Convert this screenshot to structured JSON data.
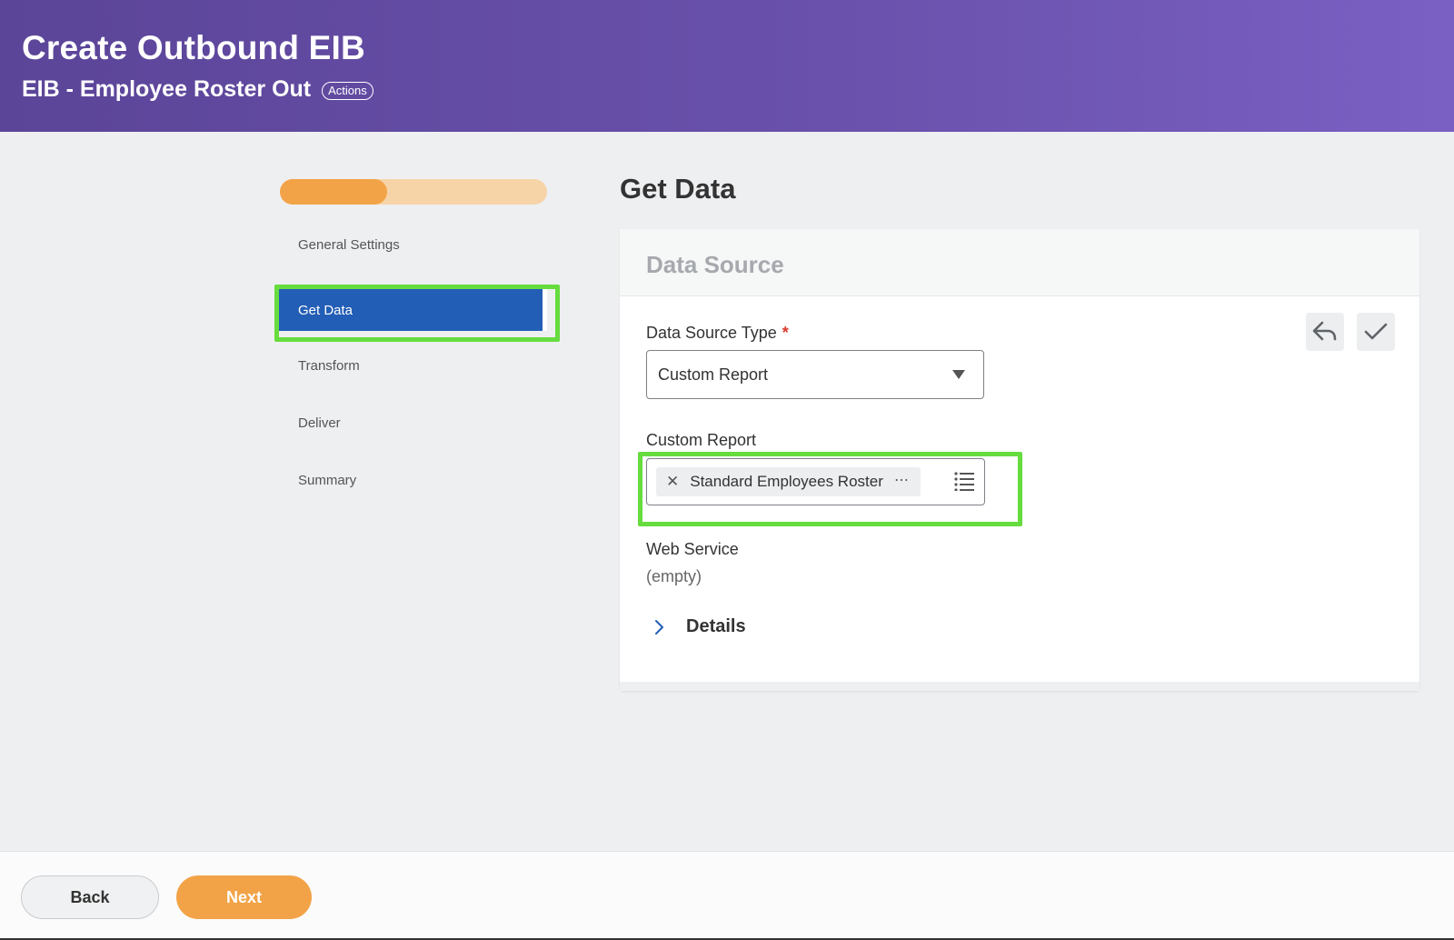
{
  "header": {
    "title": "Create Outbound EIB",
    "subtitle": "EIB - Employee Roster Out",
    "actions_label": "Actions"
  },
  "stepper": {
    "progress": 0.4,
    "steps": [
      {
        "label": "General Settings",
        "active": false
      },
      {
        "label": "Get Data",
        "active": true
      },
      {
        "label": "Transform",
        "active": false
      },
      {
        "label": "Deliver",
        "active": false
      },
      {
        "label": "Summary",
        "active": false
      }
    ]
  },
  "main": {
    "page_title": "Get Data",
    "card_title": "Data Source",
    "fields": {
      "data_source_type": {
        "label": "Data Source Type",
        "required_mark": "*",
        "value": "Custom Report"
      },
      "custom_report": {
        "label": "Custom Report",
        "selected": "Standard Employees Roster",
        "remove_glyph": "✕",
        "more_glyph": "⋯"
      },
      "web_service": {
        "label": "Web Service",
        "value": "(empty)"
      }
    },
    "details_label": "Details",
    "icons": {
      "undo": "undo-icon",
      "confirm": "checkmark-icon"
    }
  },
  "footer": {
    "back_label": "Back",
    "next_label": "Next"
  },
  "colors": {
    "header_start": "#5b4598",
    "header_end": "#7a60c3",
    "active_step": "#235eb6",
    "accent_orange": "#f2a347",
    "highlight_green": "#66dc3e",
    "required_red": "#d9392b"
  }
}
